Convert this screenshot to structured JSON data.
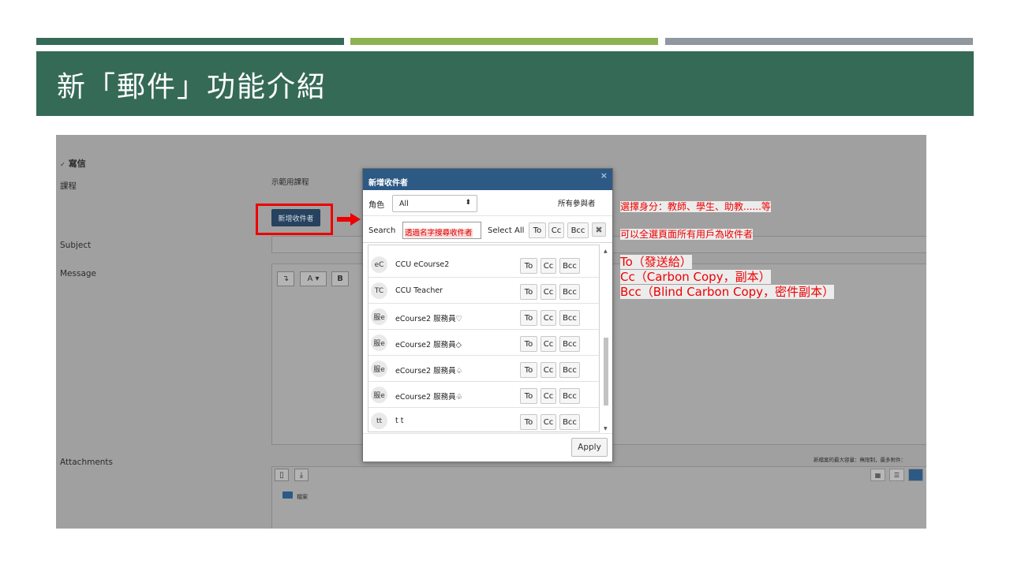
{
  "slide": {
    "title": "新「郵件」功能介紹",
    "colors": {
      "title_band": "#356a57",
      "bar1": "#356a57",
      "bar2": "#8db350",
      "bar3": "#8f979f"
    }
  },
  "form": {
    "section_label": "寫信",
    "course_label": "課程",
    "course_value": "示範用課程",
    "add_recipients_button": "新增收件者",
    "subject_label": "Subject",
    "message_label": "Message",
    "attachments_label": "Attachments",
    "limits_text": "新檔案的最大容量：無限制，最多附件：",
    "folder_label": "檔案"
  },
  "modal": {
    "title": "新增收件者",
    "role_label": "角色",
    "role_value": "All",
    "all_participants": "所有參與者",
    "search_label": "Search",
    "search_value": "透過名字搜尋收件者",
    "select_all_label": "Select All",
    "buttons": {
      "to": "To",
      "cc": "Cc",
      "bcc": "Bcc"
    },
    "apply": "Apply",
    "recipients": [
      {
        "initials": "eC",
        "name": "CCU eCourse2"
      },
      {
        "initials": "TC",
        "name": "CCU Teacher"
      },
      {
        "initials": "服e",
        "name": "eCourse2 服務員♡"
      },
      {
        "initials": "服e",
        "name": "eCourse2 服務員◇"
      },
      {
        "initials": "服e",
        "name": "eCourse2 服務員♤"
      },
      {
        "initials": "服e",
        "name": "eCourse2 服務員♧"
      },
      {
        "initials": "tt",
        "name": "t t"
      }
    ]
  },
  "annotations": {
    "role_note": "選擇身分：教師、學生、助教......等",
    "select_all_note": "可以全選頁面所有用戶為收件者",
    "to_note": "To（發送給）",
    "cc_note": "Cc（Carbon Copy，副本）",
    "bcc_note": "Bcc（Blind Carbon Copy，密件副本）",
    "highlight_color": "#ee0000"
  }
}
